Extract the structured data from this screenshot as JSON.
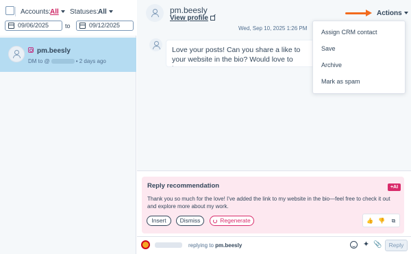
{
  "filters": {
    "accounts_label": "Accounts:",
    "accounts_value": "All",
    "statuses_label": "Statuses:",
    "statuses_value": "All",
    "date_from": "09/06/2025",
    "date_to_label": "to",
    "date_to": "09/12/2025"
  },
  "conversation_list": [
    {
      "channel_icon": "instagram-icon",
      "name": "pm.beesly",
      "meta_prefix": "DM to @",
      "meta_suffix": "• 2 days ago"
    }
  ],
  "header": {
    "contact_name": "pm.beesly",
    "view_profile": "View profile",
    "actions_label": "Actions"
  },
  "thread": {
    "timestamp": "Wed, Sep 10, 2025 1:26 PM",
    "message": "Love your posts! Can you share a like to your website in the bio? Would love to learn more!"
  },
  "actions_menu": {
    "items": [
      "Assign CRM contact",
      "Save",
      "Archive",
      "Mark as spam"
    ]
  },
  "reply_recommendation": {
    "title": "Reply recommendation",
    "ai_badge": "+AI",
    "text": "Thank you so much for the love! I've added the link to my website in the bio—feel free to check it out and explore more about my work.",
    "insert_label": "Insert",
    "dismiss_label": "Dismiss",
    "regenerate_label": "Regenerate"
  },
  "composer": {
    "replying_prefix": "replying to",
    "replying_to": "pm.beesly",
    "reply_label": "Reply"
  },
  "colors": {
    "accent": "#cc1f5f",
    "selected_row": "#b5dcf2",
    "arrow": "#f26b1d",
    "recommendation_bg": "#fde8f0"
  }
}
